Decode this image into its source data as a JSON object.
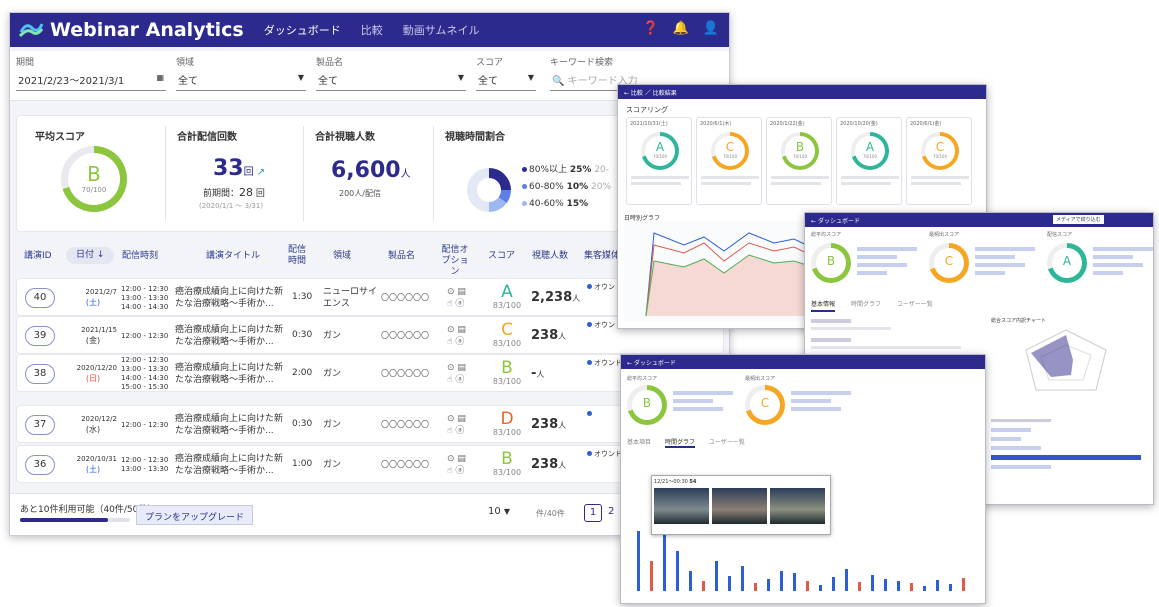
{
  "app": {
    "logo_text": "Webinar Analytics",
    "nav": [
      "ダッシュボード",
      "比較",
      "動画サムネイル"
    ]
  },
  "filters": {
    "period_label": "期間",
    "period_value": "2021/2/23〜2021/3/1",
    "area_label": "領域",
    "area_value": "全て",
    "product_label": "製品名",
    "product_value": "全て",
    "score_label": "スコア",
    "score_value": "全て",
    "keyword_label": "キーワード検索",
    "keyword_placeholder": "キーワード入力"
  },
  "summary": {
    "avg_score_title": "平均スコア",
    "avg_grade": "B",
    "avg_value": "70/100",
    "total_count_title": "合計配信回数",
    "total_count": "33",
    "total_count_unit": "回",
    "prev_label": "前期間：",
    "prev_value": "28",
    "prev_unit": "回",
    "prev_range": "(2020/1/1 〜 3/31)",
    "viewers_title": "合計視聴人数",
    "viewers": "6,600",
    "viewers_unit": "人",
    "viewers_sub": "200人/配信",
    "ratio_title": "視聴時間割合",
    "ratio_legend": [
      {
        "label": "80%以上",
        "pct": "25%"
      },
      {
        "label": "60-80%",
        "pct": "10%"
      },
      {
        "label": "40-60%",
        "pct": "15%"
      }
    ],
    "ratio_legend_right": [
      "20-",
      "20%"
    ]
  },
  "table": {
    "headers": [
      "講演ID",
      "日付",
      "配信時刻",
      "講演タイトル",
      "配信時間",
      "領域",
      "製品名",
      "配信オプション",
      "スコア",
      "視聴人数",
      "集客媒体"
    ],
    "rows": [
      {
        "id": "40",
        "date": "2021/2/7",
        "dow": "(土)",
        "times": [
          "12:00 - 12:30",
          "13:00 - 13:30",
          "14:00 - 14:30"
        ],
        "title1": "癌治療成績向上に向けた新",
        "title2": "たな治療戦略～手術か...",
        "dur": "1:30",
        "area": "ニューロサイエンス",
        "product": "〇〇〇〇〇〇",
        "grade": "A",
        "score": "83/100",
        "viewers": "2,238",
        "vunit": "人",
        "media": "オウンド"
      },
      {
        "id": "39",
        "date": "2021/1/15",
        "dow": "(金)",
        "times": [
          "12:00 - 12:30"
        ],
        "title1": "癌治療成績向上に向けた新",
        "title2": "たな治療戦略～手術か...",
        "dur": "0:30",
        "area": "ガン",
        "product": "〇〇〇〇〇〇",
        "grade": "C",
        "score": "83/100",
        "viewers": "238",
        "vunit": "人",
        "media": "オウンド"
      },
      {
        "id": "38",
        "date": "2020/12/20",
        "dow": "(日)",
        "times": [
          "12:00 - 12:30",
          "13:00 - 13:30",
          "14:00 - 14:30",
          "15:00 - 15:30"
        ],
        "title1": "癌治療成績向上に向けた新",
        "title2": "たな治療戦略～手術か...",
        "dur": "2:00",
        "area": "ガン",
        "product": "〇〇〇〇〇〇",
        "grade": "B",
        "score": "83/100",
        "viewers": "-",
        "vunit": "人",
        "media": "オウンド"
      },
      {
        "id": "37",
        "date": "2020/12/2",
        "dow": "(水)",
        "times": [
          "12:00 - 12:30"
        ],
        "title1": "癌治療成績向上に向けた新",
        "title2": "たな治療戦略～手術か...",
        "dur": "0:30",
        "area": "ガン",
        "product": "〇〇〇〇〇〇",
        "grade": "D",
        "score": "83/100",
        "viewers": "238",
        "vunit": "人",
        "media": ""
      },
      {
        "id": "36",
        "date": "2020/10/31",
        "dow": "(土)",
        "times": [
          "12:00 - 12:30",
          "13:00 - 13:30"
        ],
        "title1": "癌治療成績向上に向けた新",
        "title2": "たな治療戦略～手術か...",
        "dur": "1:00",
        "area": "ガン",
        "product": "〇〇〇〇〇〇",
        "grade": "B",
        "score": "83/100",
        "viewers": "238",
        "vunit": "人",
        "media": "オウンド"
      }
    ]
  },
  "footer": {
    "remaining": "あと10件利用可能（40件/50件）",
    "usage_fraction": 0.8,
    "upgrade": "プランをアップグレード",
    "per_page": "10",
    "per_page_suffix": "件/40件",
    "pages": [
      "1",
      "2"
    ]
  },
  "overlays": {
    "w1_title": "スコアリング",
    "w1_cards": [
      {
        "date": "2021/10/31(土)",
        "grade": "A",
        "score": "70/100"
      },
      {
        "date": "2020/6/1(木)",
        "grade": "C",
        "score": "70/100"
      },
      {
        "date": "2020/1/22(金)",
        "grade": "B",
        "score": "70/100"
      },
      {
        "date": "2020/10/20(金)",
        "grade": "A",
        "score": "70/100"
      },
      {
        "date": "2020/6/1(金)",
        "grade": "C",
        "score": "70/100"
      }
    ],
    "w1_chart_title": "日時別グラフ",
    "w2_title": "ダッシュボード",
    "w2_media": "メディアで絞り込む",
    "w2_scores": [
      "総平均スコア",
      "最頻出スコア",
      "配信スコア"
    ],
    "w2_tabs": [
      "基本情報",
      "時間グラフ",
      "ユーザー一覧"
    ],
    "w2_radar_title": "総合スコア内訳チャート",
    "w3_tabs": [
      "基本項目",
      "時間グラフ",
      "ユーザー一覧"
    ],
    "w3_scores": [
      "総平均スコア",
      "最頻出スコア"
    ],
    "w3_tooltip": "12/21〜00:30",
    "w3_tooltip2": "54"
  },
  "colors": {
    "primary": "#2c2a8c",
    "A": "#2fb59a",
    "B": "#8cc63f",
    "C": "#f5a623",
    "D": "#e8642b"
  }
}
